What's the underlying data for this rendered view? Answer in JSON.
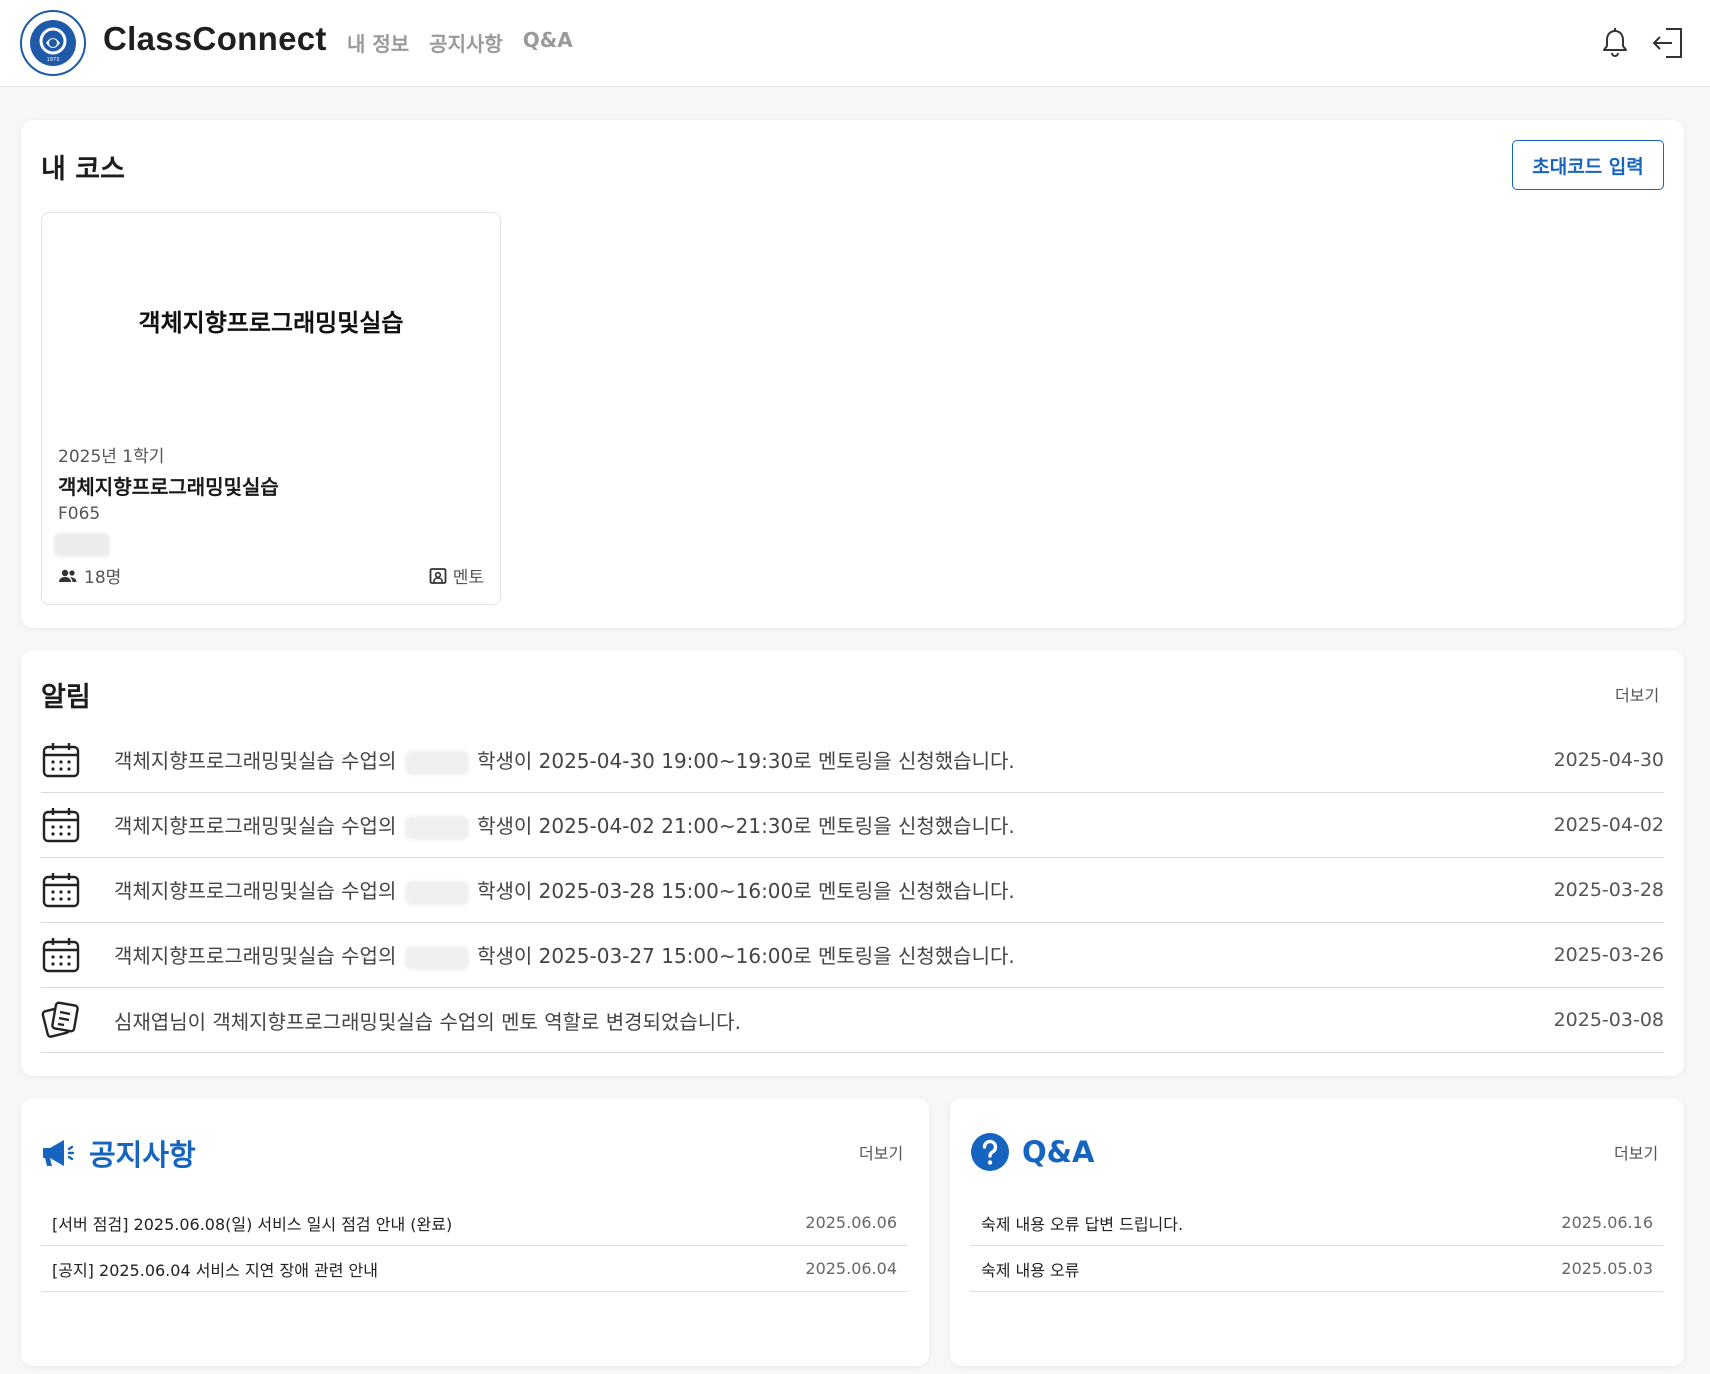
{
  "header": {
    "brand": "ClassConnect",
    "nav": [
      "내 정보",
      "공지사항",
      "Q&A"
    ],
    "logo_year": "1973",
    "logo_text_top": "아주대학교",
    "logo_text_bottom": "AJOU UNIVERSITY"
  },
  "my_courses": {
    "title": "내 코스",
    "invite_label": "초대코드 입력",
    "courses": [
      {
        "cover_title": "객체지향프로그래밍및실습",
        "semester": "2025년 1학기",
        "name": "객체지향프로그래밍및실습",
        "code": "F065",
        "member_count": "18명",
        "role": "멘토"
      }
    ]
  },
  "notifications": {
    "title": "알림",
    "more_label": "더보기",
    "items": [
      {
        "icon": "calendar-icon",
        "prefix": "객체지향프로그래밍및실습 수업의",
        "suffix": "학생이 2025-04-30 19:00~19:30로 멘토링을 신청했습니다.",
        "date": "2025-04-30"
      },
      {
        "icon": "calendar-icon",
        "prefix": "객체지향프로그래밍및실습 수업의",
        "suffix": "학생이 2025-04-02 21:00~21:30로 멘토링을 신청했습니다.",
        "date": "2025-04-02"
      },
      {
        "icon": "calendar-icon",
        "prefix": "객체지향프로그래밍및실습 수업의",
        "suffix": "학생이 2025-03-28 15:00~16:00로 멘토링을 신청했습니다.",
        "date": "2025-03-28"
      },
      {
        "icon": "calendar-icon",
        "prefix": "객체지향프로그래밍및실습 수업의",
        "suffix": "학생이 2025-03-27 15:00~16:00로 멘토링을 신청했습니다.",
        "date": "2025-03-26"
      },
      {
        "icon": "role-card-icon",
        "text": "심재엽님이 객체지향프로그래밍및실습 수업의 멘토 역할로 변경되었습니다.",
        "date": "2025-03-08"
      }
    ]
  },
  "notices": {
    "title": "공지사항",
    "more_label": "더보기",
    "items": [
      {
        "text": "[서버 점검] 2025.06.08(일) 서비스 일시 점검 안내 (완료)",
        "date": "2025.06.06"
      },
      {
        "text": "[공지] 2025.06.04 서비스 지연 장애 관련 안내",
        "date": "2025.06.04"
      }
    ]
  },
  "qna": {
    "title": "Q&A",
    "more_label": "더보기",
    "items": [
      {
        "text": "숙제 내용 오류 답변 드립니다.",
        "date": "2025.06.16"
      },
      {
        "text": "숙제 내용 오류",
        "date": "2025.05.03"
      }
    ]
  },
  "colors": {
    "accent": "#1565c0",
    "nav_text": "#9a9a9a",
    "background": "#f7f7f7"
  }
}
